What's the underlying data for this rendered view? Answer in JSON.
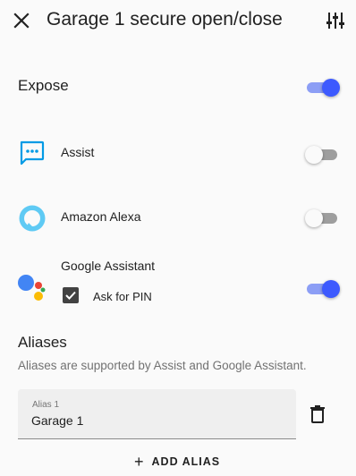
{
  "header": {
    "title": "Garage 1 secure open/close",
    "close_icon": "close-icon",
    "settings_icon": "tune-icon"
  },
  "expose": {
    "label": "Expose",
    "enabled": true
  },
  "assistants": [
    {
      "name": "Assist",
      "icon": "assist-chat-icon",
      "enabled": false,
      "color": "#039be5"
    },
    {
      "name": "Amazon Alexa",
      "icon": "alexa-icon",
      "enabled": false,
      "color": "#5fcaf4"
    },
    {
      "name": "Google Assistant",
      "icon": "google-assistant-icon",
      "enabled": true,
      "pin": {
        "label": "Ask for PIN",
        "checked": true
      }
    }
  ],
  "aliases": {
    "title": "Aliases",
    "description": "Aliases are supported by Assist and Google Assistant.",
    "items": [
      {
        "label": "Alias 1",
        "value": "Garage 1"
      }
    ],
    "add_label": "ADD ALIAS"
  },
  "colors": {
    "accent": "#3d5afe",
    "google_blue": "#4285f4",
    "google_red": "#ea4335",
    "google_yellow": "#fbbc05",
    "google_green": "#34a853"
  }
}
